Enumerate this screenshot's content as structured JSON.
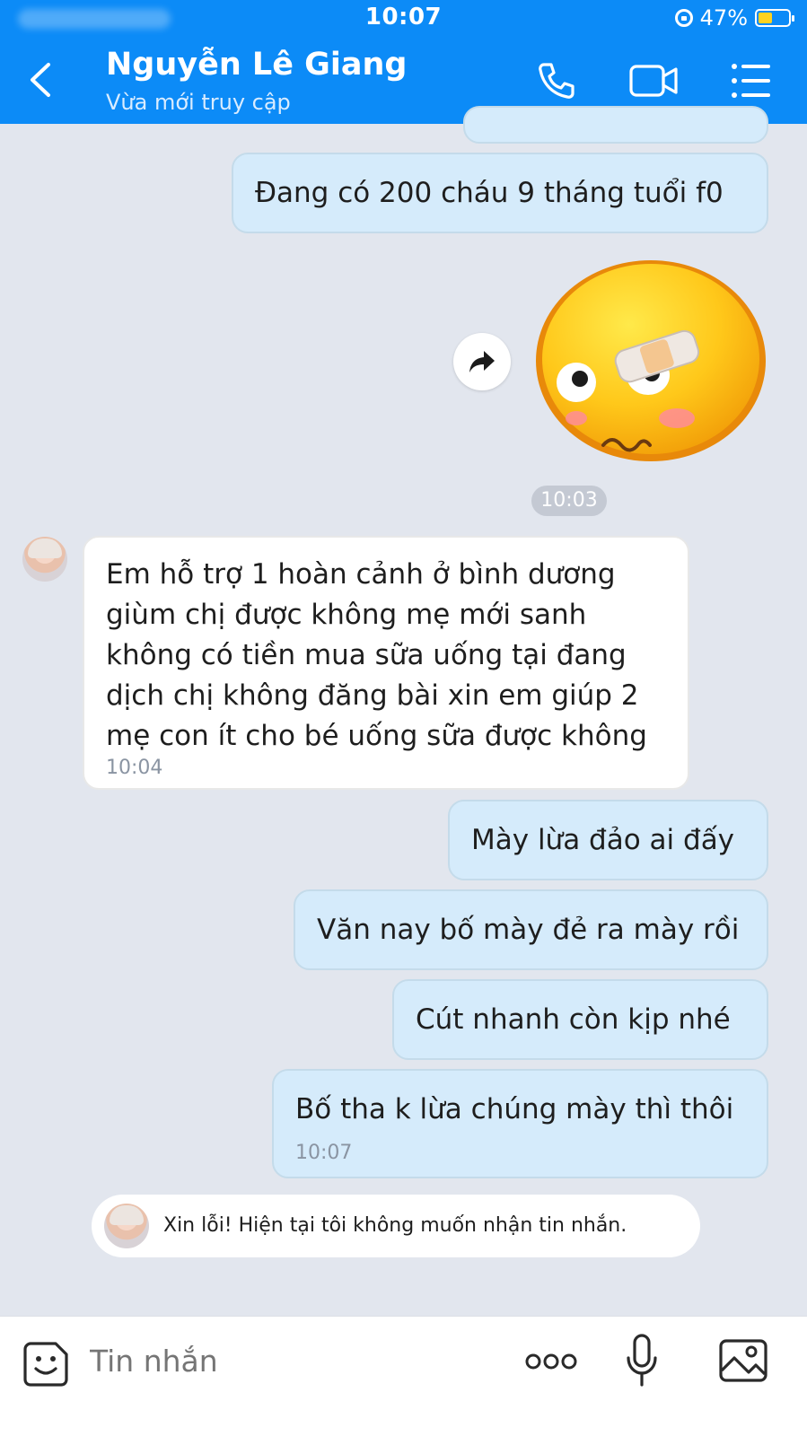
{
  "status_bar": {
    "time": "10:07",
    "battery": "47%",
    "battery_level": 0.47
  },
  "header": {
    "contact_name": "Nguyễn Lê Giang",
    "contact_status": "Vừa mới truy cập"
  },
  "messages": {
    "m1": {
      "text": "Đang có 200 cháu 9 tháng tuổi f0"
    },
    "sticker_time": "10:03",
    "m2": {
      "lines": [
        "Em hỗ trợ 1 hoàn cảnh ở bình dương",
        "giùm chị được không mẹ mới sanh",
        "không có tiền mua sữa uống tại đang",
        "dịch chị không đăng bài xin em giúp 2",
        "mẹ con ít cho bé uống sữa được không"
      ],
      "time": "10:04"
    },
    "m3": {
      "text": "Mày lừa đảo ai đấy"
    },
    "m4": {
      "text": "Văn nay bố mày đẻ ra mày rồi"
    },
    "m5": {
      "text": "Cút nhanh còn kịp nhé"
    },
    "m6": {
      "text": "Bố tha k lừa chúng mày thì thôi",
      "time": "10:07"
    }
  },
  "notice": {
    "text": "Xin lỗi! Hiện tại tôi không muốn nhận tin nhắn."
  },
  "input": {
    "placeholder": "Tin nhắn"
  },
  "icons": [
    "back-icon",
    "phone-icon",
    "video-icon",
    "menu-icon",
    "forward-icon",
    "sticker-icon",
    "more-icon",
    "mic-icon",
    "image-icon"
  ],
  "colors": {
    "header_bg": "#0c8bf7",
    "outgoing_bubble": "#d5ebfb",
    "incoming_bubble": "#ffffff",
    "chat_bg": "#e2e6ee"
  }
}
